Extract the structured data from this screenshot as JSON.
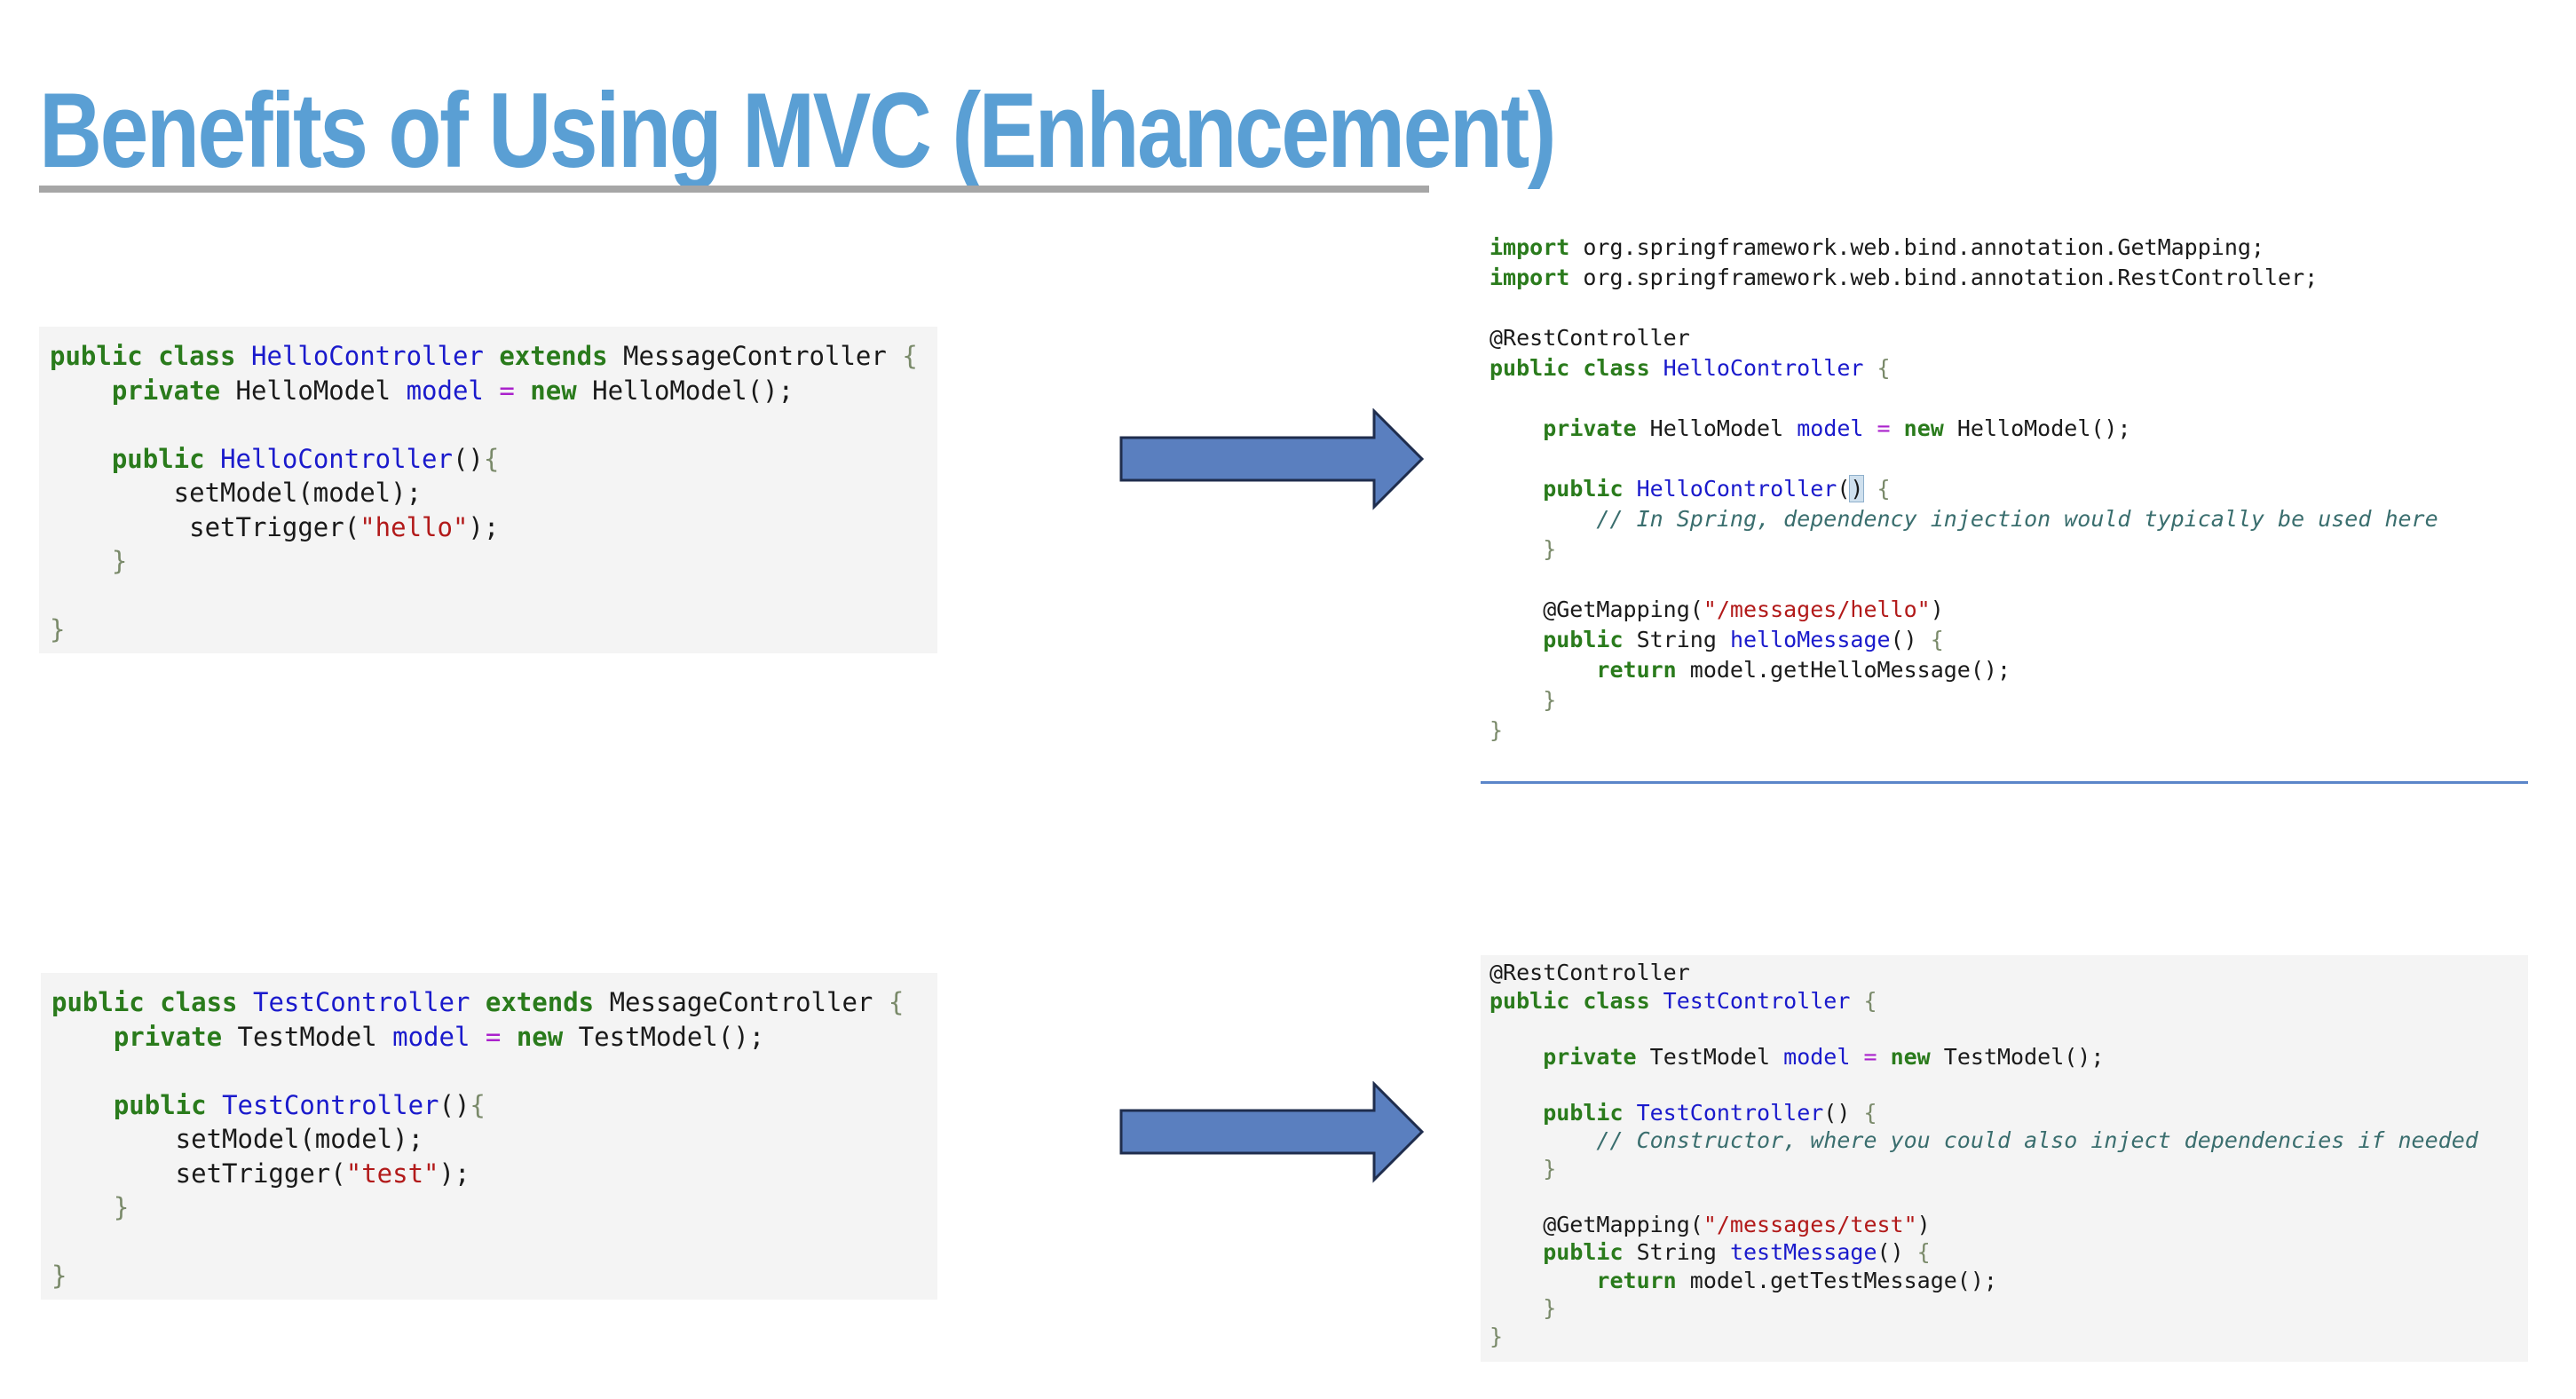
{
  "slide": {
    "title": "Benefits of Using MVC (Enhancement)"
  },
  "snippets": {
    "hello_before": [
      [
        {
          "t": "public class ",
          "c": "kw"
        },
        {
          "t": "HelloController ",
          "c": "ty"
        },
        {
          "t": "extends ",
          "c": "kw"
        },
        {
          "t": "MessageController "
        },
        {
          "t": "{",
          "c": "br"
        }
      ],
      [
        {
          "t": "    "
        },
        {
          "t": "private ",
          "c": "kw"
        },
        {
          "t": "HelloModel "
        },
        {
          "t": "model ",
          "c": "ty"
        },
        {
          "t": "= ",
          "c": "op"
        },
        {
          "t": "new ",
          "c": "kw"
        },
        {
          "t": "HelloModel();"
        }
      ],
      [],
      [
        {
          "t": "    "
        },
        {
          "t": "public ",
          "c": "kw"
        },
        {
          "t": "HelloController",
          "c": "ty"
        },
        {
          "t": "()"
        },
        {
          "t": "{",
          "c": "br"
        }
      ],
      [
        {
          "t": "        setModel(model);"
        }
      ],
      [
        {
          "t": "         setTrigger("
        },
        {
          "t": "\"hello\"",
          "c": "st"
        },
        {
          "t": ");"
        }
      ],
      [
        {
          "t": "    "
        },
        {
          "t": "}",
          "c": "br"
        }
      ],
      [],
      [
        {
          "t": "}",
          "c": "br"
        }
      ]
    ],
    "test_before": [
      [
        {
          "t": "public class ",
          "c": "kw"
        },
        {
          "t": "TestController ",
          "c": "ty"
        },
        {
          "t": "extends ",
          "c": "kw"
        },
        {
          "t": "MessageController "
        },
        {
          "t": "{",
          "c": "br"
        }
      ],
      [
        {
          "t": "    "
        },
        {
          "t": "private ",
          "c": "kw"
        },
        {
          "t": "TestModel "
        },
        {
          "t": "model ",
          "c": "ty"
        },
        {
          "t": "= ",
          "c": "op"
        },
        {
          "t": "new ",
          "c": "kw"
        },
        {
          "t": "TestModel();"
        }
      ],
      [],
      [
        {
          "t": "    "
        },
        {
          "t": "public ",
          "c": "kw"
        },
        {
          "t": "TestController",
          "c": "ty"
        },
        {
          "t": "()"
        },
        {
          "t": "{",
          "c": "br"
        }
      ],
      [
        {
          "t": "        setModel(model);"
        }
      ],
      [
        {
          "t": "        setTrigger("
        },
        {
          "t": "\"test\"",
          "c": "st"
        },
        {
          "t": ");"
        }
      ],
      [
        {
          "t": "    "
        },
        {
          "t": "}",
          "c": "br"
        }
      ],
      [],
      [
        {
          "t": "}",
          "c": "br"
        }
      ]
    ],
    "hello_after": [
      [
        {
          "t": "import ",
          "c": "kw"
        },
        {
          "t": "org.springframework.web.bind.annotation.GetMapping;"
        }
      ],
      [
        {
          "t": "import ",
          "c": "kw"
        },
        {
          "t": "org.springframework.web.bind.annotation.RestController;"
        }
      ],
      [],
      [
        {
          "t": "@RestController"
        }
      ],
      [
        {
          "t": "public class ",
          "c": "kw"
        },
        {
          "t": "HelloController ",
          "c": "ty"
        },
        {
          "t": "{",
          "c": "br"
        }
      ],
      [],
      [
        {
          "t": "    "
        },
        {
          "t": "private ",
          "c": "kw"
        },
        {
          "t": "HelloModel "
        },
        {
          "t": "model ",
          "c": "ty"
        },
        {
          "t": "= ",
          "c": "op"
        },
        {
          "t": "new ",
          "c": "kw"
        },
        {
          "t": "HelloModel();"
        }
      ],
      [],
      [
        {
          "t": "    "
        },
        {
          "t": "public ",
          "c": "kw"
        },
        {
          "t": "HelloController",
          "c": "ty"
        },
        {
          "t": "("
        },
        {
          "t": ")",
          "c": "cur"
        },
        {
          "t": " "
        },
        {
          "t": "{",
          "c": "br"
        }
      ],
      [
        {
          "t": "        "
        },
        {
          "t": "// In Spring, dependency injection would typically be used here",
          "c": "cm"
        }
      ],
      [
        {
          "t": "    "
        },
        {
          "t": "}",
          "c": "br"
        }
      ],
      [],
      [
        {
          "t": "    @GetMapping("
        },
        {
          "t": "\"/messages/hello\"",
          "c": "st"
        },
        {
          "t": ")"
        }
      ],
      [
        {
          "t": "    "
        },
        {
          "t": "public ",
          "c": "kw"
        },
        {
          "t": "String "
        },
        {
          "t": "helloMessage",
          "c": "ty"
        },
        {
          "t": "() "
        },
        {
          "t": "{",
          "c": "br"
        }
      ],
      [
        {
          "t": "        "
        },
        {
          "t": "return ",
          "c": "kw"
        },
        {
          "t": "model.getHelloMessage();"
        }
      ],
      [
        {
          "t": "    "
        },
        {
          "t": "}",
          "c": "br"
        }
      ],
      [
        {
          "t": "}",
          "c": "br"
        }
      ]
    ],
    "test_after": [
      [
        {
          "t": "@RestController"
        }
      ],
      [
        {
          "t": "public class ",
          "c": "kw"
        },
        {
          "t": "TestController ",
          "c": "ty"
        },
        {
          "t": "{",
          "c": "br"
        }
      ],
      [],
      [
        {
          "t": "    "
        },
        {
          "t": "private ",
          "c": "kw"
        },
        {
          "t": "TestModel "
        },
        {
          "t": "model ",
          "c": "ty"
        },
        {
          "t": "= ",
          "c": "op"
        },
        {
          "t": "new ",
          "c": "kw"
        },
        {
          "t": "TestModel();"
        }
      ],
      [],
      [
        {
          "t": "    "
        },
        {
          "t": "public ",
          "c": "kw"
        },
        {
          "t": "TestController",
          "c": "ty"
        },
        {
          "t": "() "
        },
        {
          "t": "{",
          "c": "br"
        }
      ],
      [
        {
          "t": "        "
        },
        {
          "t": "// Constructor, where you could also inject dependencies if needed",
          "c": "cm"
        }
      ],
      [
        {
          "t": "    "
        },
        {
          "t": "}",
          "c": "br"
        }
      ],
      [],
      [
        {
          "t": "    @GetMapping("
        },
        {
          "t": "\"/messages/test\"",
          "c": "st"
        },
        {
          "t": ")"
        }
      ],
      [
        {
          "t": "    "
        },
        {
          "t": "public ",
          "c": "kw"
        },
        {
          "t": "String "
        },
        {
          "t": "testMessage",
          "c": "ty"
        },
        {
          "t": "() "
        },
        {
          "t": "{",
          "c": "br"
        }
      ],
      [
        {
          "t": "        "
        },
        {
          "t": "return ",
          "c": "kw"
        },
        {
          "t": "model.getTestMessage();"
        }
      ],
      [
        {
          "t": "    "
        },
        {
          "t": "}",
          "c": "br"
        }
      ],
      [
        {
          "t": "}",
          "c": "br"
        }
      ]
    ]
  },
  "colors": {
    "title": "#5a9fd4",
    "arrow_fill": "#5a7fbf",
    "arrow_stroke": "#1f2d4d",
    "keyword": "#2a7b1c",
    "type": "#1a1acc",
    "string": "#b21a1a",
    "comment": "#3a6e6e"
  }
}
